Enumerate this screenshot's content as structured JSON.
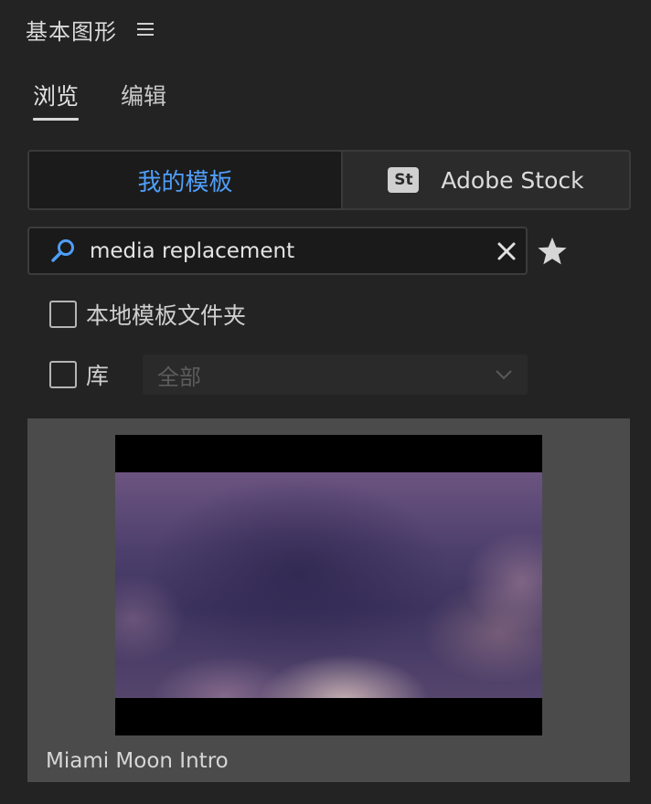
{
  "header": {
    "title": "基本图形",
    "menu_icon": "hamburger-menu-icon"
  },
  "tabs": [
    {
      "label": "浏览",
      "active": true
    },
    {
      "label": "编辑",
      "active": false
    }
  ],
  "source": {
    "my_templates_label": "我的模板",
    "stock_badge": "St",
    "stock_label": "Adobe Stock",
    "active": "my_templates",
    "active_color": "#4f9ef8"
  },
  "search": {
    "value": "media replacement",
    "icon": "search-icon",
    "clear_icon": "clear-icon",
    "accent_color": "#4f9ef8"
  },
  "favorite_icon": "star-icon",
  "filters": {
    "local_folder": {
      "label": "本地模板文件夹",
      "checked": false
    },
    "library": {
      "label": "库",
      "checked": false
    },
    "library_dropdown": {
      "selected": "全部",
      "disabled": true
    }
  },
  "results": [
    {
      "title": "Miami Moon Intro"
    }
  ]
}
